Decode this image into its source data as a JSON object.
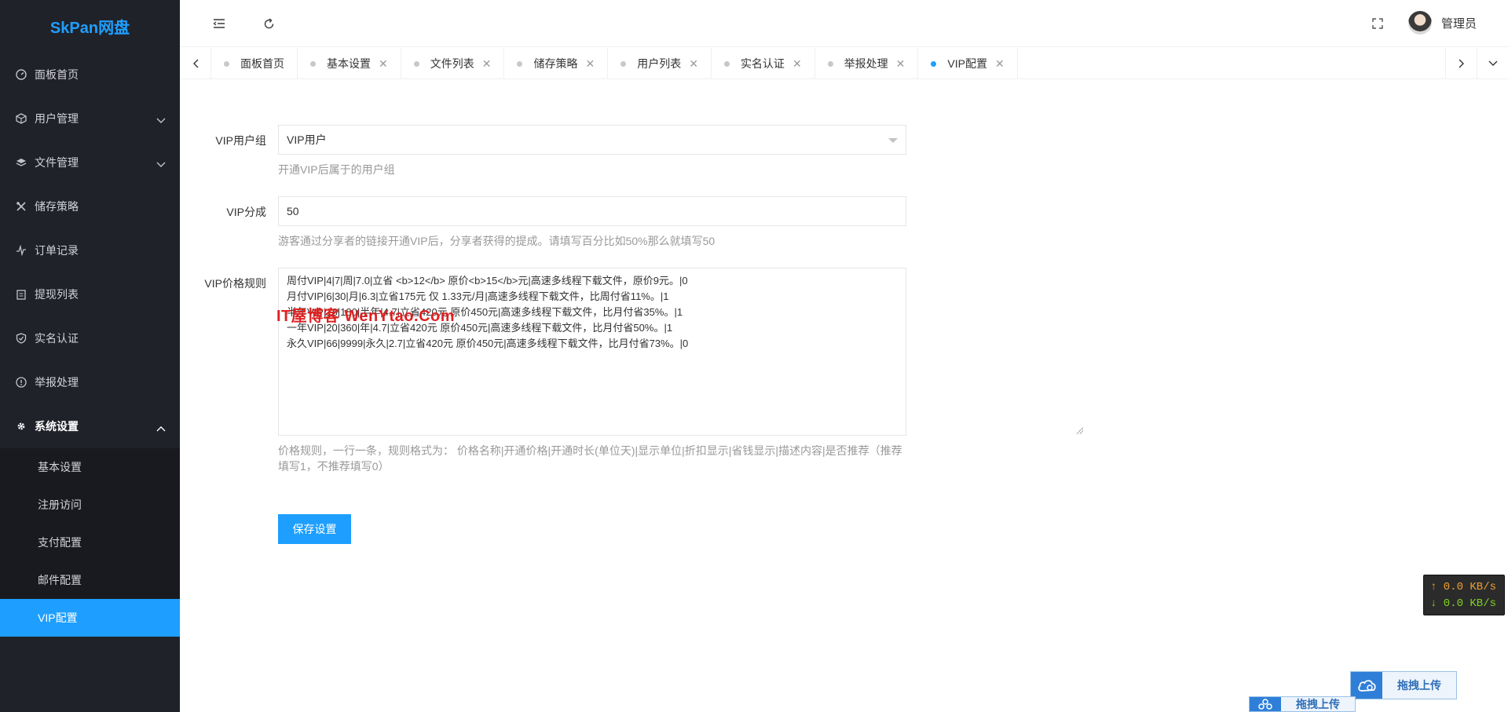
{
  "app": {
    "logo": "SkPan网盘"
  },
  "sidebar": {
    "items": [
      {
        "label": "面板首页",
        "icon": "dashboard-icon"
      },
      {
        "label": "用户管理",
        "icon": "user-box-icon"
      },
      {
        "label": "文件管理",
        "icon": "layers-icon"
      },
      {
        "label": "储存策略",
        "icon": "tools-icon"
      },
      {
        "label": "订单记录",
        "icon": "pulse-icon"
      },
      {
        "label": "提现列表",
        "icon": "clipboard-icon"
      },
      {
        "label": "实名认证",
        "icon": "shield-check-icon"
      },
      {
        "label": "举报处理",
        "icon": "info-icon"
      },
      {
        "label": "系统设置",
        "icon": "gear-icon"
      }
    ],
    "submenu": [
      {
        "label": "基本设置"
      },
      {
        "label": "注册访问"
      },
      {
        "label": "支付配置"
      },
      {
        "label": "邮件配置"
      },
      {
        "label": "VIP配置"
      }
    ]
  },
  "header": {
    "user_name": "管理员"
  },
  "tabs": [
    {
      "label": "面板首页"
    },
    {
      "label": "基本设置"
    },
    {
      "label": "文件列表"
    },
    {
      "label": "储存策略"
    },
    {
      "label": "用户列表"
    },
    {
      "label": "实名认证"
    },
    {
      "label": "举报处理"
    },
    {
      "label": "VIP配置"
    }
  ],
  "form": {
    "vip_group": {
      "label": "VIP用户组",
      "value": "VIP用户",
      "help": "开通VIP后属于的用户组"
    },
    "vip_share": {
      "label": "VIP分成",
      "value": "50",
      "help": "游客通过分享者的链接开通VIP后，分享者获得的提成。请填写百分比如50%那么就填写50"
    },
    "vip_price": {
      "label": "VIP价格规则",
      "value": "周付VIP|4|7|周|7.0|立省 <b>12</b> 原价<b>15</b>元|高速多线程下载文件，原价9元。|0\n月付VIP|6|30|月|6.3|立省175元 仅 1.33元/月|高速多线程下载文件，比周付省11%。|1\n半年VIP|18|180|半年|4.7|立省420元 原价450元|高速多线程下载文件，比月付省35%。|1\n一年VIP|20|360|年|4.7|立省420元 原价450元|高速多线程下载文件，比月付省50%。|1\n永久VIP|66|9999|永久|2.7|立省420元 原价450元|高速多线程下载文件，比月付省73%。|0",
      "help": "价格规则，一行一条，规则格式为： 价格名称|开通价格|开通时长(单位天)|显示单位|折扣显示|省钱显示|描述内容|是否推荐（推荐填写1，不推荐填写0）"
    },
    "save_label": "保存设置"
  },
  "watermark": "IT屋博客 WenYtao.Com",
  "speed": {
    "up": "↑ 0.0 KB/s",
    "down": "↓ 0.0 KB/s"
  },
  "upload": {
    "label": "拖拽上传"
  }
}
